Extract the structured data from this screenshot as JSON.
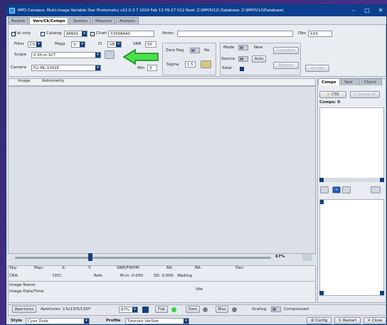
{
  "window": {
    "title": "MPO Canopus: Multi-Image Variable Star Photometry   v12.0.3.7  2024 Feb 13  09:27    V12 Root: Z:\\MPOV12\\   Database: Z:\\MPOV12\\Database\\"
  },
  "tabs": [
    "Review",
    "Vars/Ck/Comps",
    "Session",
    "Measure",
    "Analysis"
  ],
  "top": {
    "cat_only": "Cat only",
    "catalog_label": "Catalog",
    "catalog_value": "APASS",
    "chart_label": "Chart",
    "chart_value": "X35684A0",
    "notes_label": "Notes",
    "notes_value": "",
    "obs_label": "Obs",
    "obs_value": "XXX"
  },
  "filters": {
    "filter_label": "Filter",
    "filter_value": "CV",
    "mags_label": "Mags",
    "mags_value": "V",
    "ci_label": "CI",
    "ci_value": "VR",
    "snr_label": "SNR",
    "snr_value": "50",
    "scope_label": "Scope",
    "scope_value": "0.35-m SCT",
    "camera_label": "Camera",
    "camera_value": "FLI ML-1001E",
    "min_label": "Min",
    "min_value": "3"
  },
  "zero": {
    "zero_flag": "Zero flag",
    "no": "No",
    "sigma_label": "Sigma",
    "sigma_value": "1.5"
  },
  "mode": {
    "mode_label": "Mode",
    "new_label": "New",
    "source_label": "Source",
    "auto_label": "Auto",
    "solar_label": "Solar",
    "complete": "Complete",
    "refresh": "Refresh",
    "accept": "Accept"
  },
  "image_tabs": [
    "Image",
    "Astrometry"
  ],
  "zoom": {
    "value": "67%"
  },
  "status": {
    "row1": [
      "Sky:",
      "Max:",
      "X:",
      "Y:",
      "SNR/FWHM:",
      "RA:",
      "RA:",
      "Dec:"
    ],
    "row2": [
      "CRA:",
      "CDC:",
      "Refs",
      "M-m: 0.000",
      "SD: 0.000",
      "Waiting"
    ],
    "image_name": "Image Name:",
    "image_date": "Image Date/Time:",
    "idle": "Idle"
  },
  "right": {
    "tabs": [
      "Comps",
      "Vars",
      "Check"
    ],
    "css_label": "CSS",
    "delete_all": "Delete All",
    "comps_count": "Comps: 0"
  },
  "bottom": {
    "apertures_btn": "Apertures",
    "apertures_text": "Apertures: 13x13/5/13/0*",
    "zoom": "67%",
    "flat": "Flat",
    "dark": "Dark",
    "bias": "Bias",
    "scaling": "Scaling",
    "compressed": "Compressed"
  },
  "footer": {
    "style_label": "Style",
    "style_value": "Cyan Dusk",
    "profile_label": "Profile",
    "profile_value": "Tutorials VarStar",
    "config": "Config",
    "restart": "Restart",
    "close": "Close"
  },
  "colors": {
    "titlebar": "#0b3f8f",
    "accent": "#12407e",
    "arrow": "#49e24a",
    "green_dot": "#39d33a"
  }
}
